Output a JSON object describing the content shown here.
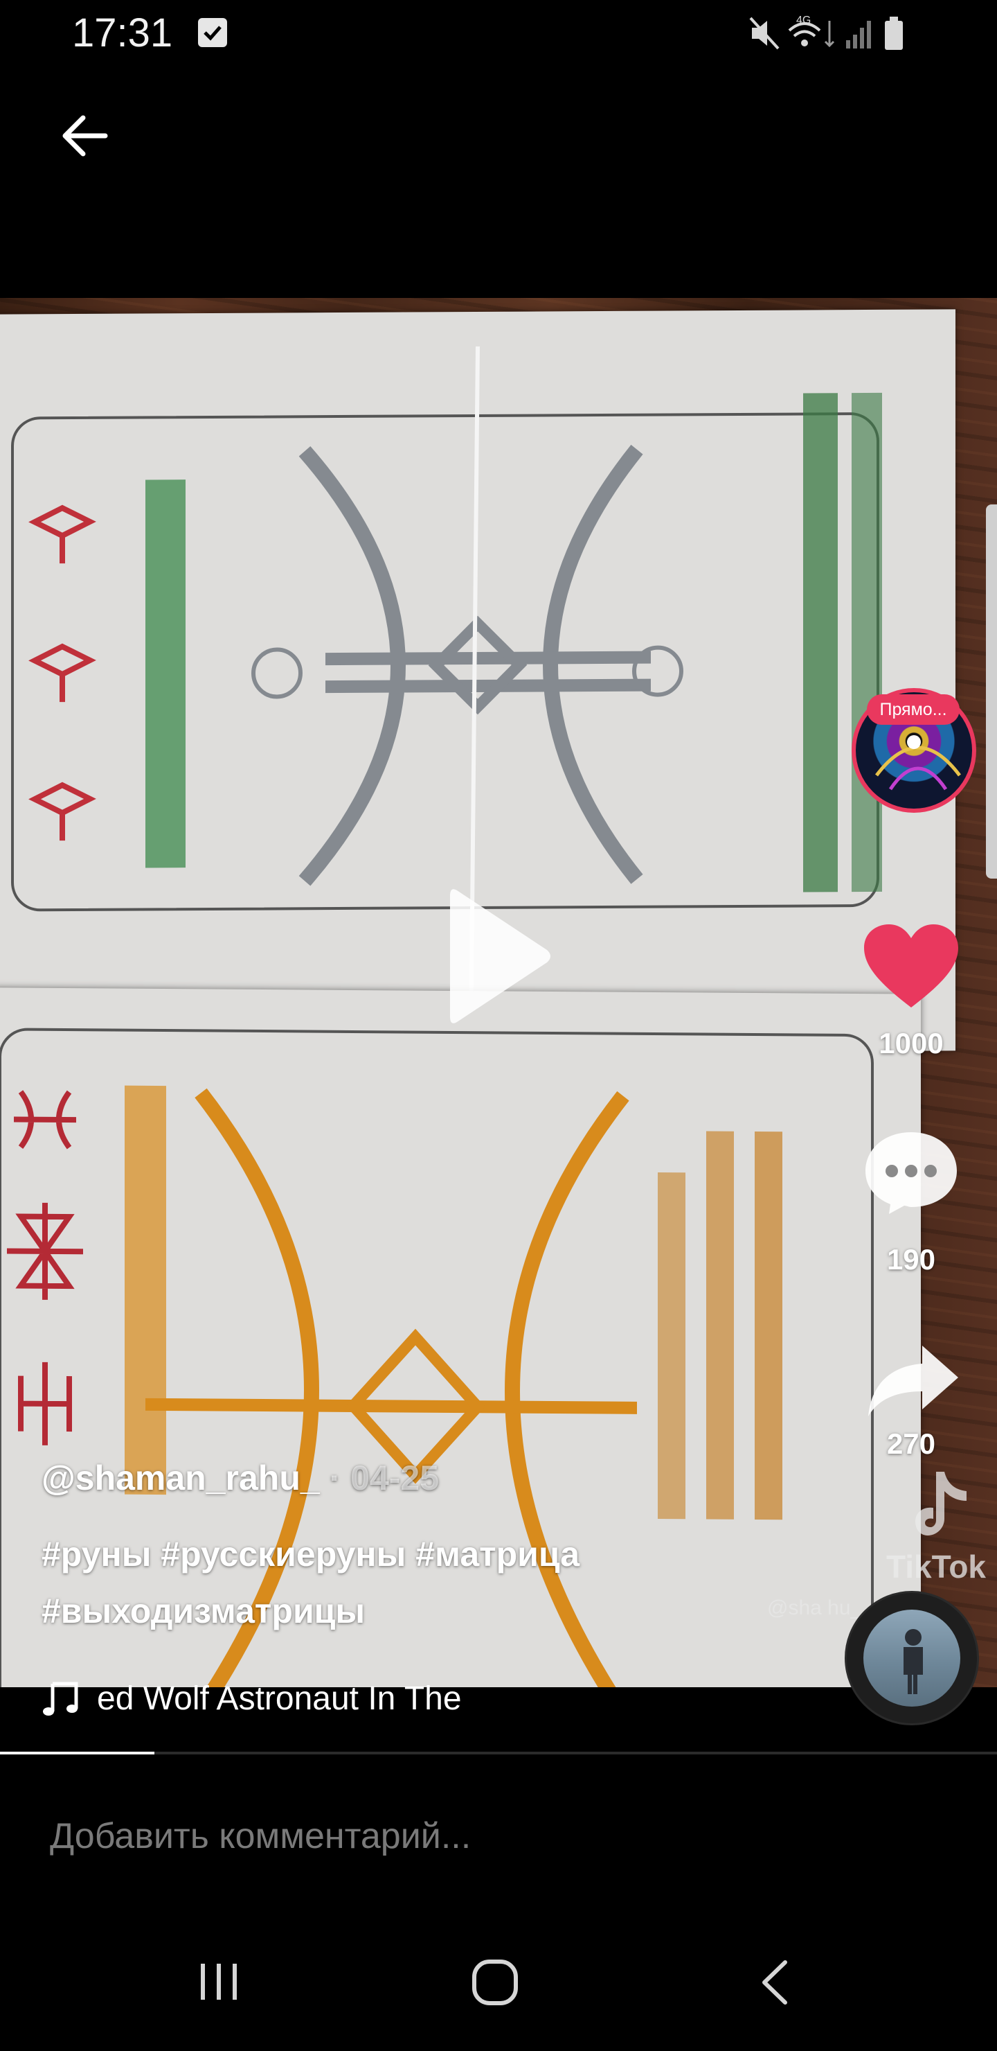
{
  "status_bar": {
    "time": "17:31",
    "network": "4G"
  },
  "video": {
    "progress_fraction": 0.155
  },
  "sidebar": {
    "live_badge": "Прямо...",
    "likes": "1000",
    "comments": "190",
    "shares": "270"
  },
  "watermark": {
    "brand": "TikTok",
    "user": "@sha       hu_"
  },
  "caption": {
    "username": "@shaman_rahu_",
    "date": " · 04-25",
    "hashtags_line1": "#руны #русскиеруны #матрица",
    "hashtags_line2": "#выходизматрицы"
  },
  "music": {
    "title": "ed Wolf     Astronaut In The"
  },
  "comment_bar": {
    "placeholder": "Добавить комментарий..."
  },
  "colors": {
    "like": "#e9385e",
    "live": "#e9385e",
    "background": "#000000"
  }
}
